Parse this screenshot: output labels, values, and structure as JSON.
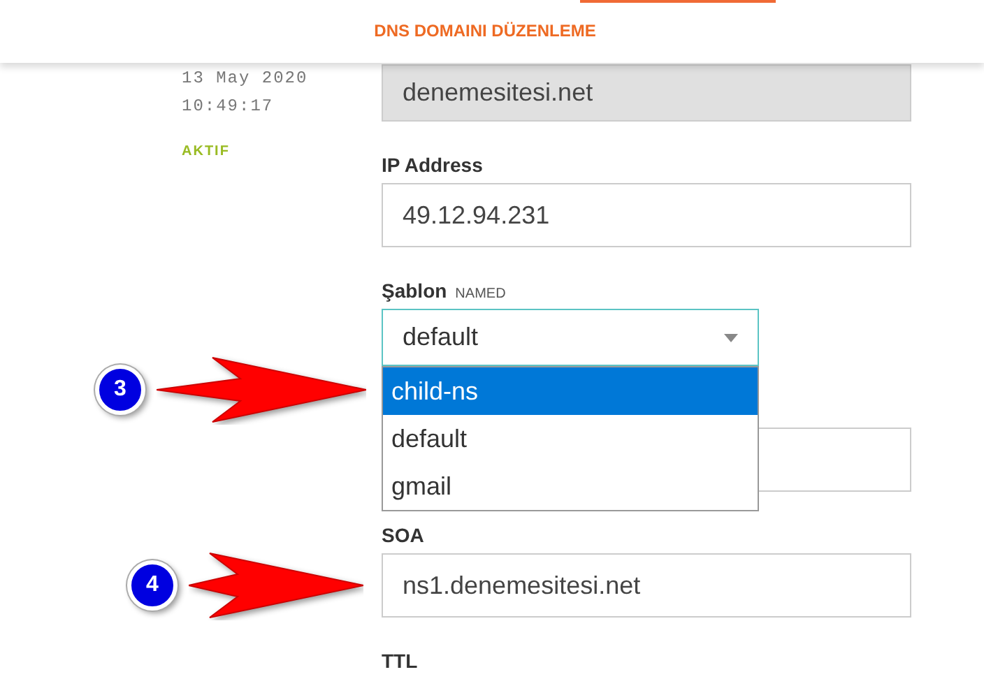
{
  "header": {
    "title": "DNS DOMAINI DÜZENLEME",
    "active_tab_marker": true
  },
  "record": {
    "date": "13 May 2020",
    "time": "10:49:17",
    "status": "AKTIF"
  },
  "fields": [
    {
      "kind": "text",
      "value": "denemesitesi.net",
      "disabled": true
    },
    {
      "kind": "text",
      "label": "IP Address",
      "value": "49.12.94.231",
      "disabled": false
    },
    {
      "kind": "select",
      "label": "Şablon",
      "hint": "NAMED",
      "value": "default",
      "open": true,
      "options": [
        {
          "label": "child-ns",
          "highlighted": true
        },
        {
          "label": "default",
          "highlighted": false
        },
        {
          "label": "gmail",
          "highlighted": false
        }
      ]
    },
    {
      "kind": "text",
      "disabled": false
    },
    {
      "kind": "text",
      "label": "SOA",
      "value": "ns1.denemesitesi.net",
      "disabled": false
    },
    {
      "kind": "label",
      "label": "TTL"
    }
  ],
  "annotations": [
    {
      "number": "3"
    },
    {
      "number": "4"
    }
  ]
}
